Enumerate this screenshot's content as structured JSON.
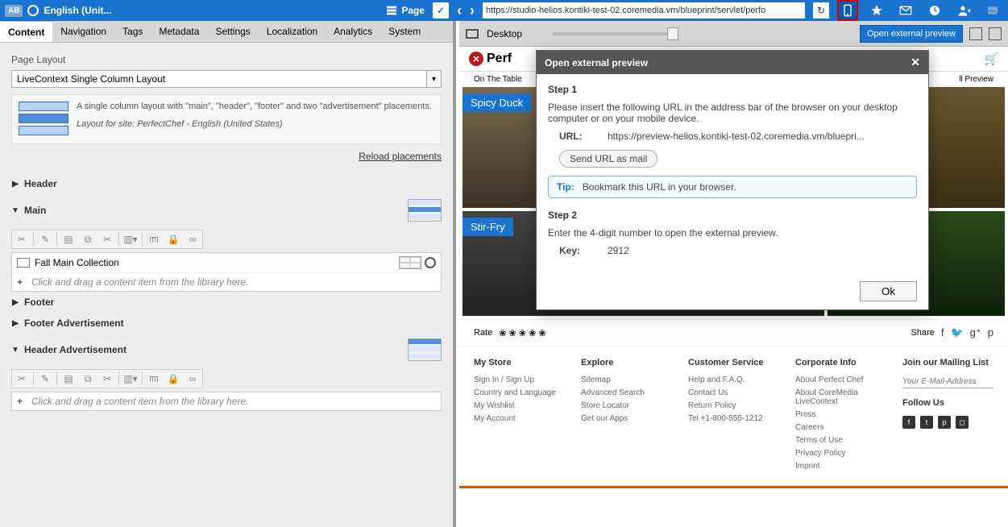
{
  "topbar": {
    "ab": "AB",
    "locale": "English (Unit...",
    "page_label": "Page",
    "url": "https://studio-helios.kontiki-test-02.coremedia.vm/blueprint/servlet/perfo"
  },
  "preview_bar": {
    "device": "Desktop",
    "tooltip": "Open external preview"
  },
  "tabs": {
    "items": [
      "Content",
      "Navigation",
      "Tags",
      "Metadata",
      "Settings",
      "Localization",
      "Analytics",
      "System"
    ],
    "active": 0
  },
  "layout": {
    "title": "Page Layout",
    "value": "LiveContext Single Column Layout",
    "desc": "A single column layout with \"main\", \"header\", \"footer\" and two \"advertisement\" placements.",
    "site_info": "Layout for site: PerfectChef - English (United States)",
    "reload": "Reload placements"
  },
  "accordion": {
    "header": "Header",
    "main": "Main",
    "footer": "Footer",
    "footer_ad": "Footer Advertisement",
    "header_ad": "Header Advertisement",
    "fall_collection": "Fall Main Collection",
    "drop_hint": "Click and drag a content item from the library here."
  },
  "site": {
    "brand": "Perf",
    "nav1": "On The Table",
    "nav2": "ll Preview",
    "tag1": "Spicy Duck",
    "tag2": "Stir-Fry",
    "rate": "Rate",
    "share": "Share"
  },
  "footer": {
    "cols": [
      {
        "h": "My Store",
        "links": [
          "Sign In / Sign Up",
          "Country and Language",
          "My Wishlist",
          "My Account"
        ]
      },
      {
        "h": "Explore",
        "links": [
          "Sitemap",
          "Advanced Search",
          "Store Locator",
          "Get our Apps"
        ]
      },
      {
        "h": "Customer Service",
        "links": [
          "Help and F.A.Q.",
          "Contact Us",
          "Return Policy",
          "Tel +1-800-555-1212"
        ]
      },
      {
        "h": "Corporate Info",
        "links": [
          "About Perfect Chef",
          "About CoreMedia LiveContext",
          "Press",
          "Careers",
          "Terms of Use",
          "Privacy Policy",
          "Imprint"
        ]
      }
    ],
    "mail_h": "Join our Mailing List",
    "mail_ph": "Your E-Mail-Address",
    "follow_h": "Follow Us"
  },
  "modal": {
    "title": "Open external preview",
    "step1": "Step 1",
    "step1_text": "Please insert the following URL in the address bar of the browser on your desktop computer or on your mobile device.",
    "url_label": "URL:",
    "url_value": "https://preview-helios.kontiki-test-02.coremedia.vm/bluepri...",
    "mail_btn": "Send URL as mail",
    "tip_label": "Tip:",
    "tip_text": "Bookmark this URL in your browser.",
    "step2": "Step 2",
    "step2_text": "Enter the 4-digit number to open the external preview.",
    "key_label": "Key:",
    "key_value": "2912",
    "ok": "Ok"
  }
}
